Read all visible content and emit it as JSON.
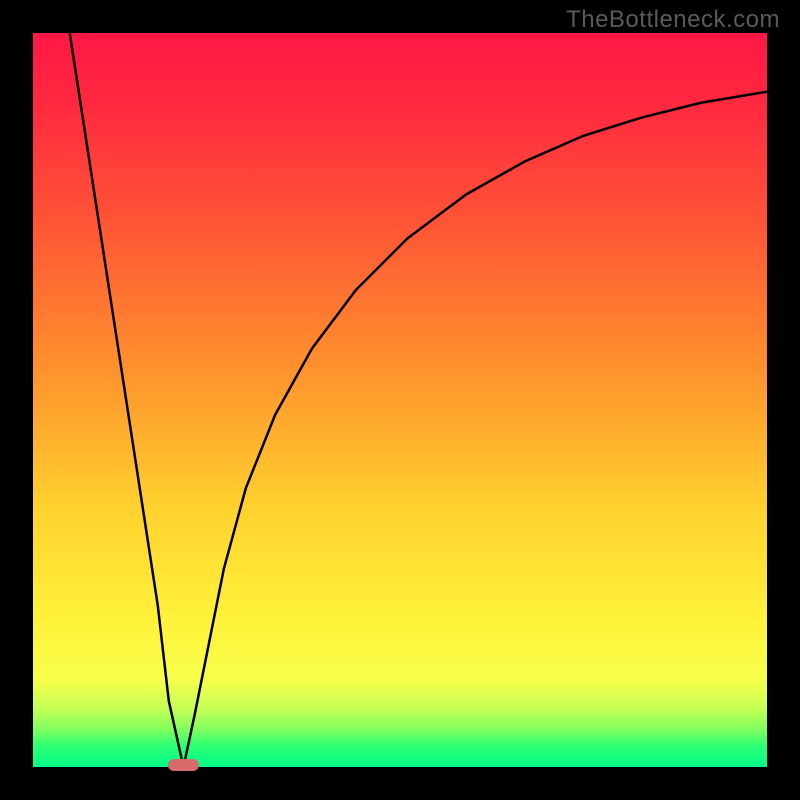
{
  "watermark": "TheBottleneck.com",
  "chart_data": {
    "type": "line",
    "title": "",
    "xlabel": "",
    "ylabel": "",
    "xlim": [
      0,
      100
    ],
    "ylim": [
      0,
      100
    ],
    "grid": false,
    "series": [
      {
        "name": "bottleneck-curve",
        "x": [
          5,
          7,
          9,
          11,
          13,
          15,
          17,
          18.5,
          20.5,
          22,
          24,
          26,
          29,
          33,
          38,
          44,
          51,
          59,
          67,
          75,
          83,
          91,
          100
        ],
        "y": [
          100,
          87,
          74,
          61,
          48,
          35,
          22,
          9,
          0,
          7,
          17,
          27,
          38,
          48,
          57,
          65,
          72,
          78,
          82.5,
          86,
          88.5,
          90.5,
          92
        ]
      }
    ],
    "marker": {
      "x": 20.5,
      "y": 0,
      "width_pct": 4.2,
      "height_pct": 1.6,
      "color": "#d76a6a"
    },
    "gradient_stops": [
      {
        "pct": 0,
        "color": "#ff1744"
      },
      {
        "pct": 45,
        "color": "#ff8f2d"
      },
      {
        "pct": 80,
        "color": "#fff23a"
      },
      {
        "pct": 100,
        "color": "#00ff88"
      }
    ]
  },
  "layout": {
    "image_size": 800,
    "border": 33,
    "plot_size": 734
  }
}
